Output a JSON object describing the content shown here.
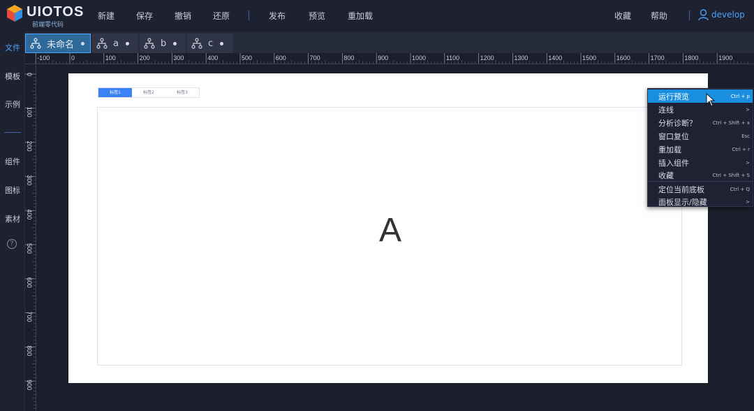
{
  "brand": {
    "name": "UIOTOS",
    "subtitle": "前端零代码"
  },
  "topmenu": {
    "new": "新建",
    "save": "保存",
    "undo": "撤销",
    "redo": "还原",
    "publish": "发布",
    "preview": "预览",
    "reload": "重加载",
    "favorite": "收藏",
    "help": "帮助",
    "user": "develop"
  },
  "sidebar": {
    "file": "文件",
    "template": "模板",
    "example": "示例",
    "component": "组件",
    "icon": "图标",
    "material": "素材",
    "help_symbol": "?"
  },
  "tabs": [
    {
      "label": "未命名"
    },
    {
      "label": "a"
    },
    {
      "label": "b"
    },
    {
      "label": "c"
    }
  ],
  "ruler_h": [
    "-100",
    "0",
    "100",
    "200",
    "300",
    "400",
    "500",
    "600",
    "700",
    "800",
    "900",
    "1000",
    "1100",
    "1200",
    "1300",
    "1400",
    "1500",
    "1600",
    "1700",
    "1800",
    "1900"
  ],
  "ruler_v": [
    "0",
    "100",
    "200",
    "300",
    "400",
    "500",
    "600",
    "700",
    "800",
    "900"
  ],
  "canvas": {
    "tabs": [
      "标签1",
      "标签2",
      "标签3"
    ],
    "content": "A"
  },
  "context_menu": [
    {
      "label": "运行预览",
      "shortcut": "Ctrl + p"
    },
    {
      "label": "连线",
      "shortcut": ">"
    },
    {
      "label": "分析诊断？",
      "shortcut": "Ctrl + Shift + x"
    },
    {
      "label": "窗口复位",
      "shortcut": "Esc"
    },
    {
      "label": "重加载",
      "shortcut": "Ctrl + r"
    },
    {
      "label": "插入组件",
      "shortcut": ">"
    },
    {
      "label": "收藏",
      "shortcut": "Ctrl + Shift + S"
    },
    {
      "label": "定位当前底板",
      "shortcut": "Ctrl + Q"
    },
    {
      "label": "面板显示/隐藏",
      "shortcut": ">"
    }
  ],
  "colors": {
    "accent": "#1a8fe0",
    "link": "#4aa3ff",
    "tab_active": "#3b82f6"
  }
}
